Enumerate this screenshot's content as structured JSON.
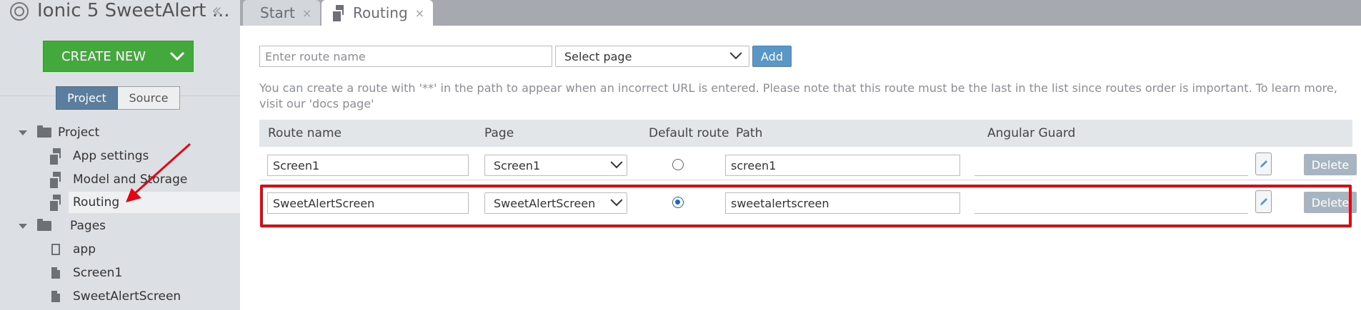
{
  "app": {
    "title": "Ionic 5 SweetAlert ..."
  },
  "sidebar": {
    "create_new_label": "CREATE NEW",
    "segments": {
      "project": "Project",
      "source": "Source"
    },
    "tree": {
      "project": "Project",
      "app_settings": "App settings",
      "model_storage": "Model and Storage",
      "routing": "Routing",
      "pages": "Pages",
      "app": "app",
      "screen1": "Screen1",
      "sweetalert": "SweetAlertScreen"
    }
  },
  "tabs": {
    "start": "Start",
    "routing": "Routing",
    "close_glyph": "×"
  },
  "main": {
    "route_name_placeholder": "Enter route name",
    "select_page_label": "Select page",
    "add_label": "Add",
    "note": "You can create a route with '**' in the path to appear when an incorrect URL is entered. Please note that this route must be the last in the list since routes order is important. To learn more, visit our 'docs page'",
    "columns": {
      "route_name": "Route name",
      "page": "Page",
      "default_route": "Default route",
      "path": "Path",
      "angular_guard": "Angular Guard"
    },
    "rows": [
      {
        "route_name": "Screen1",
        "page": "Screen1",
        "default": false,
        "path": "screen1",
        "guard": "",
        "delete_label": "Delete"
      },
      {
        "route_name": "SweetAlertScreen",
        "page": "SweetAlertScreen",
        "default": true,
        "path": "sweetalertscreen",
        "guard": "",
        "delete_label": "Delete"
      }
    ]
  },
  "colors": {
    "create_new": "#43a93d",
    "segment_active": "#5b7e9e",
    "add_button": "#5a96c8",
    "delete_button": "#a7b4c2",
    "highlight_red": "#e30613",
    "radio_checked": "#1a66c9"
  }
}
